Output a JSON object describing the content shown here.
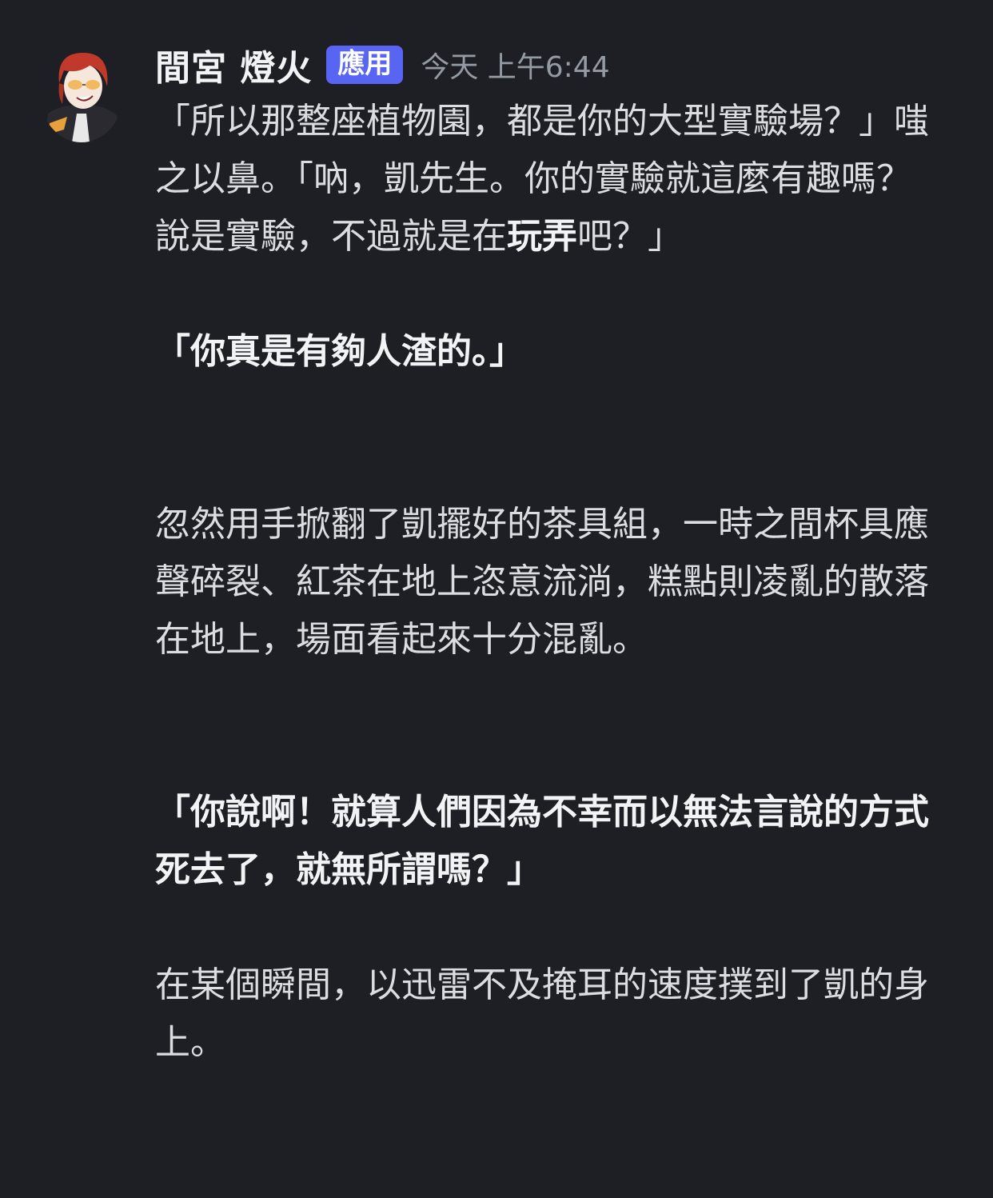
{
  "author": {
    "name": "間宮 燈火",
    "app_tag": "應用",
    "timestamp": "今天 上午6:44",
    "avatar": "anime-character-avatar"
  },
  "message": {
    "p1_main": "「所以那整座植物園，都是你的大型實驗場？」嗤之以鼻。「吶，凱先生。你的實驗就這麼有趣嗎？說是實驗，不過就是在",
    "p1_bold": "玩弄",
    "p1_tail": "吧？」",
    "p2": "「你真是有夠人渣的。」",
    "p3": "忽然用手掀翻了凱擺好的茶具組，一時之間杯具應聲碎裂、紅茶在地上恣意流淌，糕點則凌亂的散落在地上，場面看起來十分混亂。",
    "p4": "「你說啊！就算人們因為不幸而以無法言說的方式死去了，就無所謂嗎？」",
    "p5": "在某個瞬間，以迅雷不及掩耳的速度撲到了凱的身上。"
  },
  "colors": {
    "background": "#1e1f24",
    "app_tag": "#5865f2",
    "text": "#dcdde1",
    "timestamp": "#949ba4"
  }
}
